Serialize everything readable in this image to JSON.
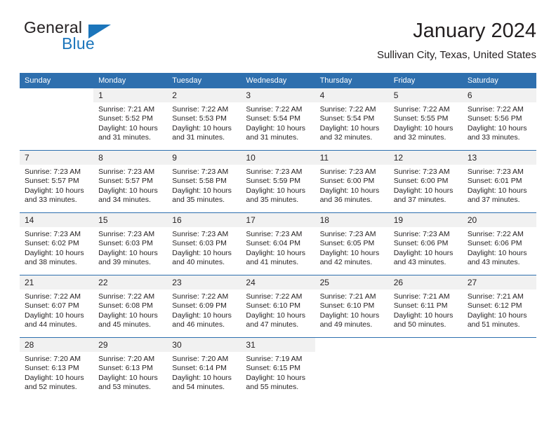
{
  "brand": {
    "word_one": "General",
    "word_two": "Blue",
    "logo_icon": "flag-triangle-icon",
    "accent_color": "#1b75bb"
  },
  "header": {
    "month_title": "January 2024",
    "location": "Sullivan City, Texas, United States"
  },
  "theme": {
    "header_bar_color": "#2e6fae",
    "daynum_band_color": "#f1f1f1",
    "text_color": "#231f20"
  },
  "calendar": {
    "weekday_headers": [
      "Sunday",
      "Monday",
      "Tuesday",
      "Wednesday",
      "Thursday",
      "Friday",
      "Saturday"
    ],
    "weeks": [
      [
        {
          "day": "",
          "blank": true,
          "sunrise": "",
          "sunset": "",
          "daylight_line1": "",
          "daylight_line2": ""
        },
        {
          "day": "1",
          "sunrise": "Sunrise: 7:21 AM",
          "sunset": "Sunset: 5:52 PM",
          "daylight_line1": "Daylight: 10 hours",
          "daylight_line2": "and 31 minutes."
        },
        {
          "day": "2",
          "sunrise": "Sunrise: 7:22 AM",
          "sunset": "Sunset: 5:53 PM",
          "daylight_line1": "Daylight: 10 hours",
          "daylight_line2": "and 31 minutes."
        },
        {
          "day": "3",
          "sunrise": "Sunrise: 7:22 AM",
          "sunset": "Sunset: 5:54 PM",
          "daylight_line1": "Daylight: 10 hours",
          "daylight_line2": "and 31 minutes."
        },
        {
          "day": "4",
          "sunrise": "Sunrise: 7:22 AM",
          "sunset": "Sunset: 5:54 PM",
          "daylight_line1": "Daylight: 10 hours",
          "daylight_line2": "and 32 minutes."
        },
        {
          "day": "5",
          "sunrise": "Sunrise: 7:22 AM",
          "sunset": "Sunset: 5:55 PM",
          "daylight_line1": "Daylight: 10 hours",
          "daylight_line2": "and 32 minutes."
        },
        {
          "day": "6",
          "sunrise": "Sunrise: 7:22 AM",
          "sunset": "Sunset: 5:56 PM",
          "daylight_line1": "Daylight: 10 hours",
          "daylight_line2": "and 33 minutes."
        }
      ],
      [
        {
          "day": "7",
          "sunrise": "Sunrise: 7:23 AM",
          "sunset": "Sunset: 5:57 PM",
          "daylight_line1": "Daylight: 10 hours",
          "daylight_line2": "and 33 minutes."
        },
        {
          "day": "8",
          "sunrise": "Sunrise: 7:23 AM",
          "sunset": "Sunset: 5:57 PM",
          "daylight_line1": "Daylight: 10 hours",
          "daylight_line2": "and 34 minutes."
        },
        {
          "day": "9",
          "sunrise": "Sunrise: 7:23 AM",
          "sunset": "Sunset: 5:58 PM",
          "daylight_line1": "Daylight: 10 hours",
          "daylight_line2": "and 35 minutes."
        },
        {
          "day": "10",
          "sunrise": "Sunrise: 7:23 AM",
          "sunset": "Sunset: 5:59 PM",
          "daylight_line1": "Daylight: 10 hours",
          "daylight_line2": "and 35 minutes."
        },
        {
          "day": "11",
          "sunrise": "Sunrise: 7:23 AM",
          "sunset": "Sunset: 6:00 PM",
          "daylight_line1": "Daylight: 10 hours",
          "daylight_line2": "and 36 minutes."
        },
        {
          "day": "12",
          "sunrise": "Sunrise: 7:23 AM",
          "sunset": "Sunset: 6:00 PM",
          "daylight_line1": "Daylight: 10 hours",
          "daylight_line2": "and 37 minutes."
        },
        {
          "day": "13",
          "sunrise": "Sunrise: 7:23 AM",
          "sunset": "Sunset: 6:01 PM",
          "daylight_line1": "Daylight: 10 hours",
          "daylight_line2": "and 37 minutes."
        }
      ],
      [
        {
          "day": "14",
          "sunrise": "Sunrise: 7:23 AM",
          "sunset": "Sunset: 6:02 PM",
          "daylight_line1": "Daylight: 10 hours",
          "daylight_line2": "and 38 minutes."
        },
        {
          "day": "15",
          "sunrise": "Sunrise: 7:23 AM",
          "sunset": "Sunset: 6:03 PM",
          "daylight_line1": "Daylight: 10 hours",
          "daylight_line2": "and 39 minutes."
        },
        {
          "day": "16",
          "sunrise": "Sunrise: 7:23 AM",
          "sunset": "Sunset: 6:03 PM",
          "daylight_line1": "Daylight: 10 hours",
          "daylight_line2": "and 40 minutes."
        },
        {
          "day": "17",
          "sunrise": "Sunrise: 7:23 AM",
          "sunset": "Sunset: 6:04 PM",
          "daylight_line1": "Daylight: 10 hours",
          "daylight_line2": "and 41 minutes."
        },
        {
          "day": "18",
          "sunrise": "Sunrise: 7:23 AM",
          "sunset": "Sunset: 6:05 PM",
          "daylight_line1": "Daylight: 10 hours",
          "daylight_line2": "and 42 minutes."
        },
        {
          "day": "19",
          "sunrise": "Sunrise: 7:23 AM",
          "sunset": "Sunset: 6:06 PM",
          "daylight_line1": "Daylight: 10 hours",
          "daylight_line2": "and 43 minutes."
        },
        {
          "day": "20",
          "sunrise": "Sunrise: 7:22 AM",
          "sunset": "Sunset: 6:06 PM",
          "daylight_line1": "Daylight: 10 hours",
          "daylight_line2": "and 43 minutes."
        }
      ],
      [
        {
          "day": "21",
          "sunrise": "Sunrise: 7:22 AM",
          "sunset": "Sunset: 6:07 PM",
          "daylight_line1": "Daylight: 10 hours",
          "daylight_line2": "and 44 minutes."
        },
        {
          "day": "22",
          "sunrise": "Sunrise: 7:22 AM",
          "sunset": "Sunset: 6:08 PM",
          "daylight_line1": "Daylight: 10 hours",
          "daylight_line2": "and 45 minutes."
        },
        {
          "day": "23",
          "sunrise": "Sunrise: 7:22 AM",
          "sunset": "Sunset: 6:09 PM",
          "daylight_line1": "Daylight: 10 hours",
          "daylight_line2": "and 46 minutes."
        },
        {
          "day": "24",
          "sunrise": "Sunrise: 7:22 AM",
          "sunset": "Sunset: 6:10 PM",
          "daylight_line1": "Daylight: 10 hours",
          "daylight_line2": "and 47 minutes."
        },
        {
          "day": "25",
          "sunrise": "Sunrise: 7:21 AM",
          "sunset": "Sunset: 6:10 PM",
          "daylight_line1": "Daylight: 10 hours",
          "daylight_line2": "and 49 minutes."
        },
        {
          "day": "26",
          "sunrise": "Sunrise: 7:21 AM",
          "sunset": "Sunset: 6:11 PM",
          "daylight_line1": "Daylight: 10 hours",
          "daylight_line2": "and 50 minutes."
        },
        {
          "day": "27",
          "sunrise": "Sunrise: 7:21 AM",
          "sunset": "Sunset: 6:12 PM",
          "daylight_line1": "Daylight: 10 hours",
          "daylight_line2": "and 51 minutes."
        }
      ],
      [
        {
          "day": "28",
          "sunrise": "Sunrise: 7:20 AM",
          "sunset": "Sunset: 6:13 PM",
          "daylight_line1": "Daylight: 10 hours",
          "daylight_line2": "and 52 minutes."
        },
        {
          "day": "29",
          "sunrise": "Sunrise: 7:20 AM",
          "sunset": "Sunset: 6:13 PM",
          "daylight_line1": "Daylight: 10 hours",
          "daylight_line2": "and 53 minutes."
        },
        {
          "day": "30",
          "sunrise": "Sunrise: 7:20 AM",
          "sunset": "Sunset: 6:14 PM",
          "daylight_line1": "Daylight: 10 hours",
          "daylight_line2": "and 54 minutes."
        },
        {
          "day": "31",
          "sunrise": "Sunrise: 7:19 AM",
          "sunset": "Sunset: 6:15 PM",
          "daylight_line1": "Daylight: 10 hours",
          "daylight_line2": "and 55 minutes."
        },
        {
          "day": "",
          "blank": true,
          "sunrise": "",
          "sunset": "",
          "daylight_line1": "",
          "daylight_line2": ""
        },
        {
          "day": "",
          "blank": true,
          "sunrise": "",
          "sunset": "",
          "daylight_line1": "",
          "daylight_line2": ""
        },
        {
          "day": "",
          "blank": true,
          "sunrise": "",
          "sunset": "",
          "daylight_line1": "",
          "daylight_line2": ""
        }
      ]
    ]
  }
}
